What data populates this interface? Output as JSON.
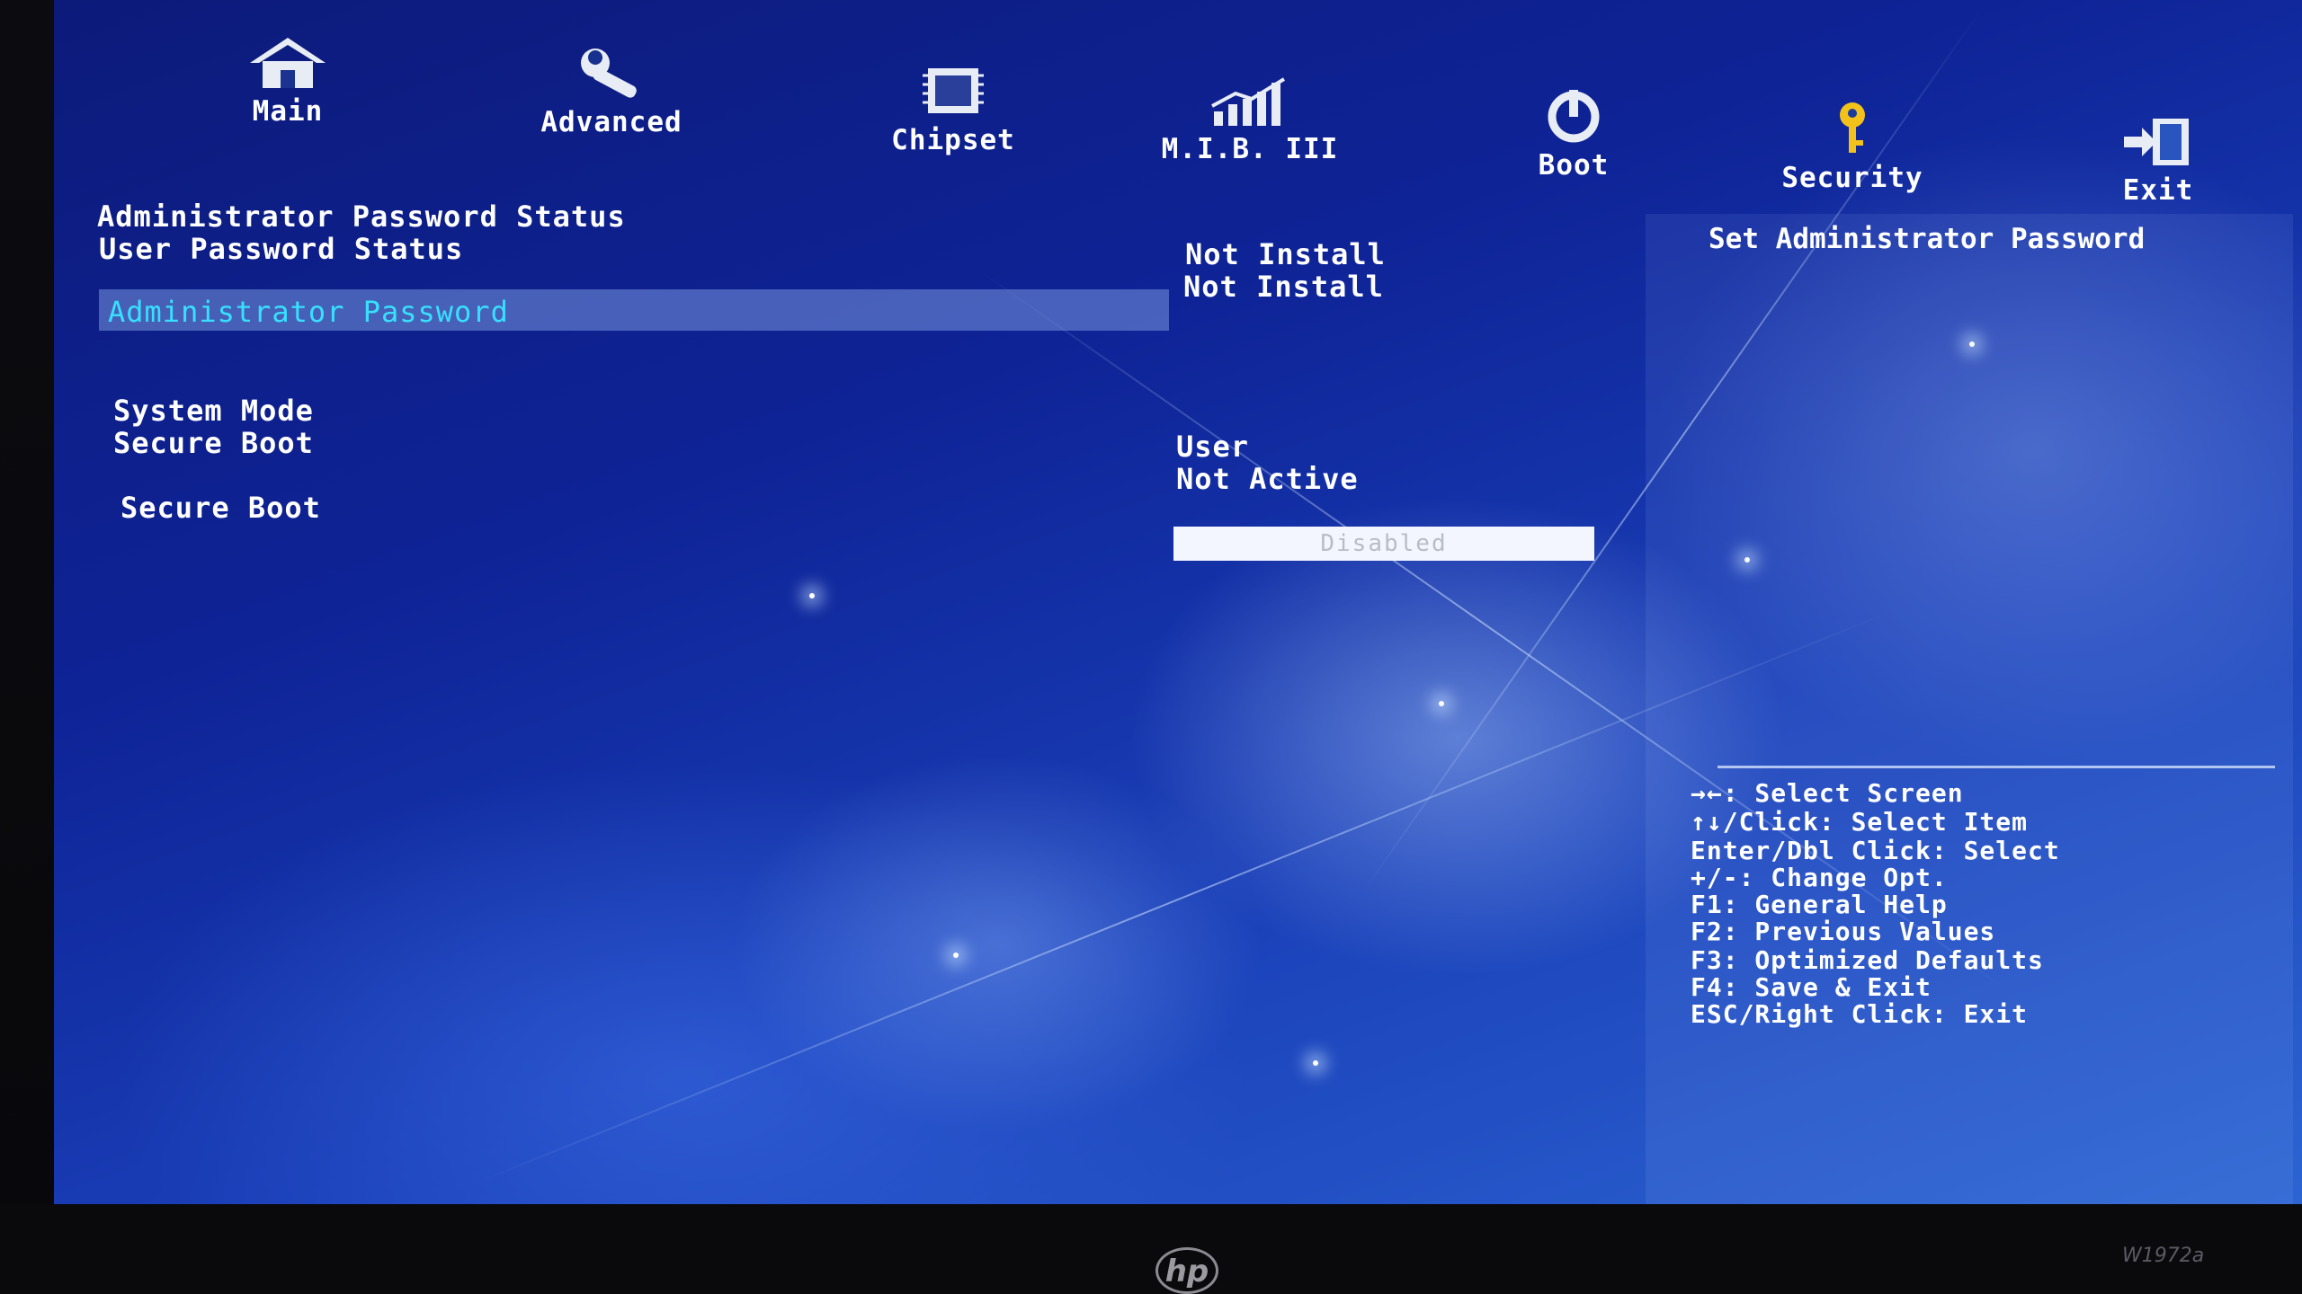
{
  "tabs": [
    {
      "label": "Main",
      "icon": "home-icon"
    },
    {
      "label": "Advanced",
      "icon": "wrench-icon"
    },
    {
      "label": "Chipset",
      "icon": "chip-icon"
    },
    {
      "label": "M.I.B. III",
      "icon": "chart-icon"
    },
    {
      "label": "Boot",
      "icon": "power-icon"
    },
    {
      "label": "Security",
      "icon": "key-icon"
    },
    {
      "label": "Exit",
      "icon": "exit-icon"
    }
  ],
  "active_tab": "Security",
  "security": {
    "admin_status_label": "Administrator Password Status",
    "user_status_label": "User Password Status",
    "admin_status_value": "Not Install",
    "user_status_value": "Not Install",
    "admin_password_label": "Administrator Password",
    "system_mode_label": "System Mode",
    "secure_boot_status_label": "Secure Boot",
    "system_mode_value": "User",
    "secure_boot_status_value": "Not Active",
    "secure_boot_option_label": "Secure Boot",
    "secure_boot_option_value": "Disabled"
  },
  "help": {
    "title": "Set Administrator Password",
    "keys": [
      "→←: Select Screen",
      "↑↓/Click: Select Item",
      "Enter/Dbl Click: Select",
      "+/-: Change Opt.",
      "F1: General Help",
      "F2: Previous Values",
      "F3: Optimized Defaults",
      "F4: Save & Exit",
      "ESC/Right Click: Exit"
    ]
  },
  "monitor": {
    "brand": "hp",
    "model": "W1972a"
  },
  "colors": {
    "background": "#0e2396",
    "highlight_text": "#38e0ff",
    "key_icon": "#f2c21a"
  }
}
